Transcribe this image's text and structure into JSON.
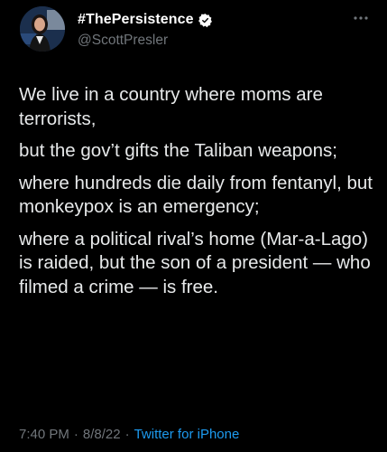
{
  "tweet": {
    "display_name": "#ThePersistence",
    "handle": "@ScottPresler",
    "paragraphs": [
      "We live in a country where moms are terrorists,",
      "but the gov’t gifts the Taliban weapons;",
      "where hundreds die daily from fentanyl, but monkeypox is an emergency;",
      "where a political rival’s home (Mar-a-Lago) is raided, but the son of a president — who filmed a crime — is free."
    ],
    "time": "7:40 PM",
    "date": "8/8/22",
    "source": "Twitter for iPhone",
    "separator": "·"
  },
  "colors": {
    "background": "#000000",
    "text": "#e7e9ea",
    "muted": "#71767b",
    "accent": "#1d9bf0"
  },
  "icons": {
    "verified": "verified-badge-icon",
    "more": "more-options-icon"
  }
}
